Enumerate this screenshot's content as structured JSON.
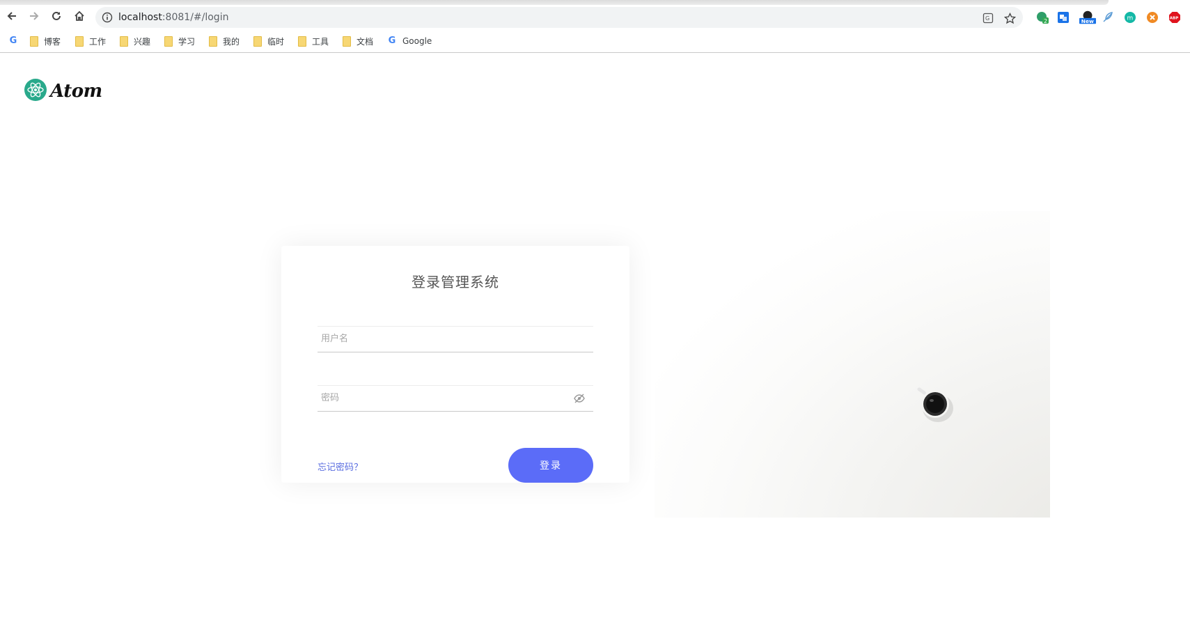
{
  "browser": {
    "url_host": "localhost",
    "url_rest": ":8081/#/login",
    "extensions": [
      {
        "name": "notification-extension-icon",
        "badge": "2",
        "color": "#2f9e69"
      },
      {
        "name": "translate-extension-icon",
        "badge": "",
        "color": "#1a73e8"
      },
      {
        "name": "new-extension-icon",
        "badge": "New",
        "color": "#222222"
      },
      {
        "name": "feather-extension-icon",
        "badge": "",
        "color": "#5a9bd5"
      },
      {
        "name": "m-extension-icon",
        "badge": "m",
        "color": "#14b8a6"
      },
      {
        "name": "close-circle-extension-icon",
        "badge": "",
        "color": "#f08a24"
      },
      {
        "name": "adblock-extension-icon",
        "badge": "ABP",
        "color": "#e0141e"
      }
    ]
  },
  "bookmarks": [
    {
      "label": "博客",
      "type": "folder"
    },
    {
      "label": "工作",
      "type": "folder"
    },
    {
      "label": "兴趣",
      "type": "folder"
    },
    {
      "label": "学习",
      "type": "folder"
    },
    {
      "label": "我的",
      "type": "folder"
    },
    {
      "label": "临时",
      "type": "folder"
    },
    {
      "label": "工具",
      "type": "folder"
    },
    {
      "label": "文档",
      "type": "folder"
    },
    {
      "label": "Google",
      "type": "google"
    }
  ],
  "page": {
    "logo_text": "Atom",
    "logo_color": "#29a98b",
    "title": "登录管理系统",
    "username_placeholder": "用户名",
    "password_placeholder": "密码",
    "forgot_password": "忘记密码？",
    "login_button": "登录",
    "accent_color": "#5b6cf8"
  }
}
